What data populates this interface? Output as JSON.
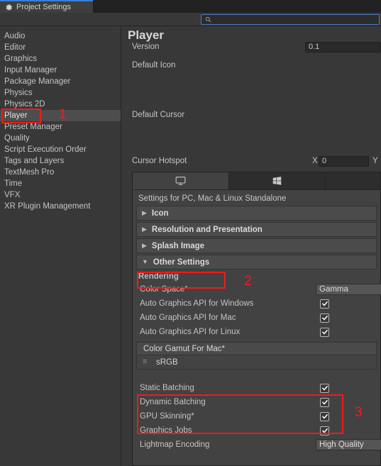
{
  "window": {
    "tab_label": "Project Settings",
    "tab_icon": "gear-icon"
  },
  "search": {
    "value": "",
    "placeholder": "",
    "icon": "search-icon"
  },
  "sidebar": {
    "items": [
      {
        "label": "Audio",
        "selected": false
      },
      {
        "label": "Editor",
        "selected": false
      },
      {
        "label": "Graphics",
        "selected": false
      },
      {
        "label": "Input Manager",
        "selected": false
      },
      {
        "label": "Package Manager",
        "selected": false
      },
      {
        "label": "Physics",
        "selected": false
      },
      {
        "label": "Physics 2D",
        "selected": false
      },
      {
        "label": "Player",
        "selected": true
      },
      {
        "label": "Preset Manager",
        "selected": false
      },
      {
        "label": "Quality",
        "selected": false
      },
      {
        "label": "Script Execution Order",
        "selected": false
      },
      {
        "label": "Tags and Layers",
        "selected": false
      },
      {
        "label": "TextMesh Pro",
        "selected": false
      },
      {
        "label": "Time",
        "selected": false
      },
      {
        "label": "VFX",
        "selected": false
      },
      {
        "label": "XR Plugin Management",
        "selected": false
      }
    ]
  },
  "main": {
    "title": "Player",
    "top_props": {
      "version_label": "Version",
      "version_value": "0.1",
      "default_icon_label": "Default Icon",
      "default_cursor_label": "Default Cursor",
      "cursor_hotspot_label": "Cursor Hotspot",
      "cursor_x_label": "X",
      "cursor_x_value": "0",
      "cursor_y_label": "Y"
    },
    "platform_tabs": [
      {
        "icon": "monitor-icon",
        "active": true
      },
      {
        "icon": "windows-icon",
        "active": false
      }
    ],
    "platform_caption": "Settings for PC, Mac & Linux Standalone",
    "foldouts": [
      {
        "label": "Icon",
        "expanded": false,
        "arrow": "▶"
      },
      {
        "label": "Resolution and Presentation",
        "expanded": false,
        "arrow": "▶"
      },
      {
        "label": "Splash Image",
        "expanded": false,
        "arrow": "▶"
      },
      {
        "label": "Other Settings",
        "expanded": true,
        "arrow": "▼"
      }
    ],
    "rendering_header": "Rendering",
    "rendering_rows": [
      {
        "label": "Color Space*",
        "type": "dropdown",
        "value": "Gamma"
      },
      {
        "label": "Auto Graphics API  for Windows",
        "type": "checkbox",
        "checked": true
      },
      {
        "label": "Auto Graphics API  for Mac",
        "type": "checkbox",
        "checked": true
      },
      {
        "label": "Auto Graphics API  for Linux",
        "type": "checkbox",
        "checked": true
      }
    ],
    "color_gamut": {
      "header": "Color Gamut For Mac*",
      "items": [
        {
          "label": "sRGB",
          "handle": "≡"
        }
      ]
    },
    "batching_rows": [
      {
        "label": "Static Batching",
        "type": "checkbox",
        "checked": true
      },
      {
        "label": "Dynamic Batching",
        "type": "checkbox",
        "checked": true
      },
      {
        "label": "GPU Skinning*",
        "type": "checkbox",
        "checked": true
      },
      {
        "label": "Graphics Jobs",
        "type": "checkbox",
        "checked": true
      },
      {
        "label": "Lightmap Encoding",
        "type": "dropdown",
        "value": "High Quality"
      }
    ]
  },
  "annotations": [
    {
      "number": "1",
      "target": "sidebar-item-player"
    },
    {
      "number": "2",
      "target": "foldout-other-settings"
    },
    {
      "number": "3",
      "target": "batching-group"
    }
  ],
  "colors": {
    "accent_blue": "#3b7fd4",
    "annotation_red": "#f41a1a",
    "panel_bg": "#383838",
    "group_bg": "#424242"
  }
}
